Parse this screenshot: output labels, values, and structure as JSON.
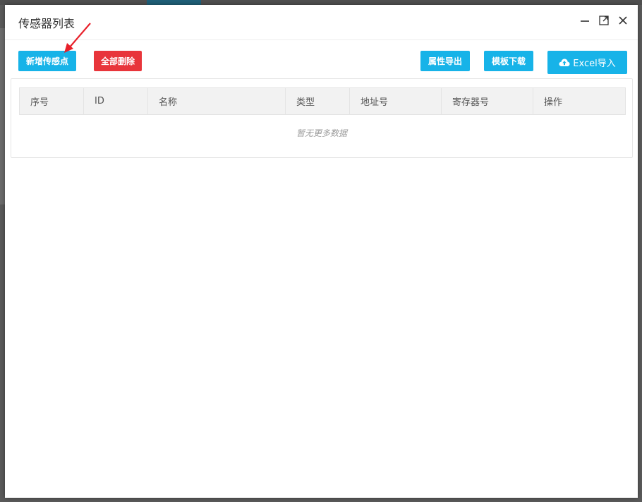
{
  "dialog": {
    "title": "传感器列表"
  },
  "window_controls": [
    {
      "name": "minimize-icon"
    },
    {
      "name": "maximize-icon"
    },
    {
      "name": "close-icon"
    }
  ],
  "toolbar": {
    "add_label": "新增传感点",
    "delete_all_label": "全部删除",
    "export_props_label": "属性导出",
    "template_download_label": "模板下载",
    "excel_import_label": "Excel导入",
    "excel_import_icon": "cloud-upload-icon"
  },
  "table": {
    "columns": [
      "序号",
      "ID",
      "名称",
      "类型",
      "地址号",
      "寄存器号",
      "操作"
    ],
    "empty_text": "暂无更多数据"
  },
  "colors": {
    "primary": "#17b3e8",
    "danger": "#e8353b",
    "annotation_arrow": "#e8202a"
  }
}
